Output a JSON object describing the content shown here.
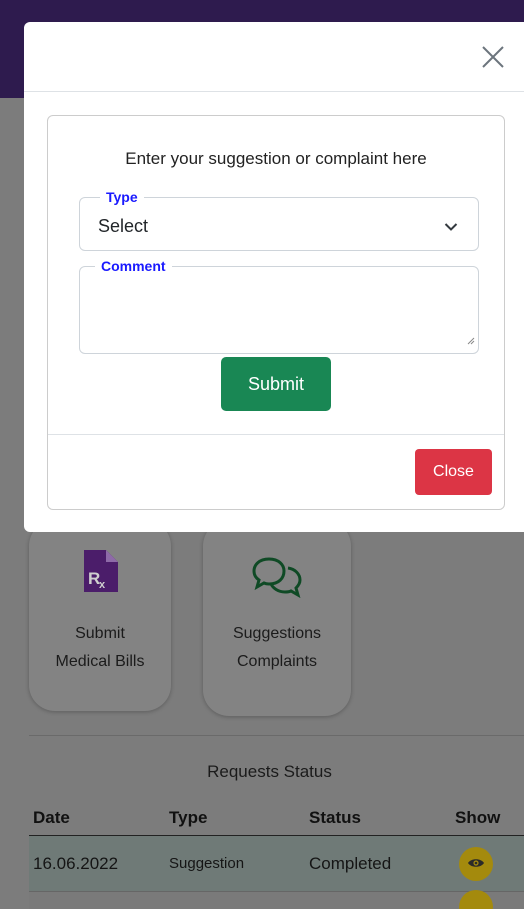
{
  "modal": {
    "card_title": "Enter your suggestion or complaint here",
    "type_legend": "Type",
    "type_selected": "Select",
    "comment_legend": "Comment",
    "comment_value": "",
    "submit_label": "Submit",
    "close_label": "Close"
  },
  "tiles": [
    {
      "line1": "Submit",
      "line2": "Medical Bills",
      "icon": "prescription-file-icon"
    },
    {
      "line1": "Suggestions",
      "line2": "Complaints",
      "icon": "chat-bubbles-icon"
    }
  ],
  "requests": {
    "title": "Requests Status",
    "headers": [
      "Date",
      "Type",
      "Status",
      "Show"
    ],
    "rows": [
      {
        "date": "16.06.2022",
        "type": "Suggestion",
        "status": "Completed"
      }
    ]
  },
  "colors": {
    "accent_purple": "#2e1b4e",
    "tile_icon_purple": "#6a1b9a",
    "tile_icon_green": "#0f5f2e",
    "submit_green": "#198754",
    "close_red": "#dc3545",
    "legend_blue": "#1a1aff",
    "show_yellow": "#a48a0d"
  }
}
